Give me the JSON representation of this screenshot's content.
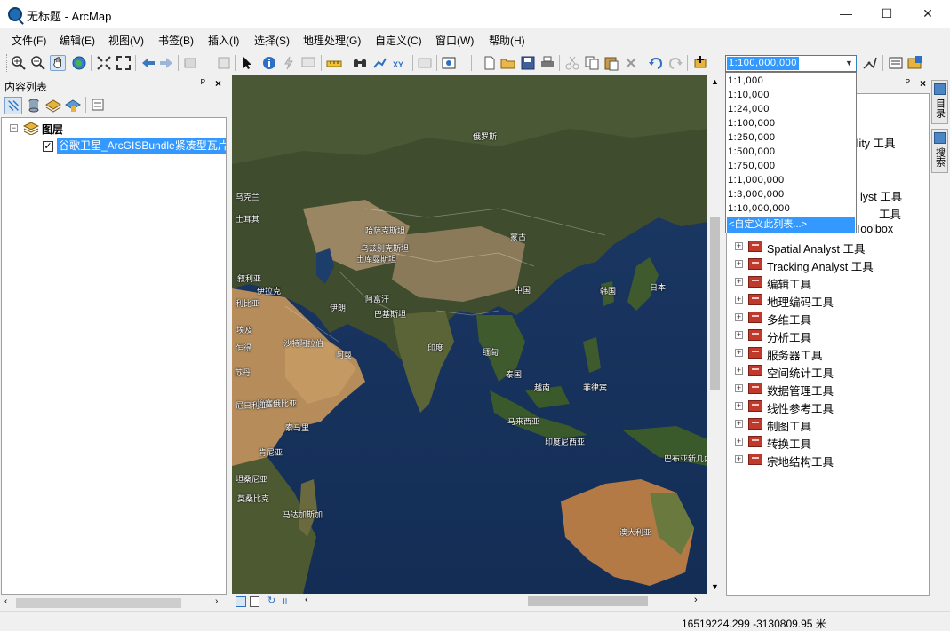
{
  "window": {
    "title": "无标题 - ArcMap",
    "minimize": "—",
    "maximize": "☐",
    "close": "✕"
  },
  "menu": [
    "文件(F)",
    "编辑(E)",
    "视图(V)",
    "书签(B)",
    "插入(I)",
    "选择(S)",
    "地理处理(G)",
    "自定义(C)",
    "窗口(W)",
    "帮助(H)"
  ],
  "toolbar": {
    "scale_value": "1:100,000,000",
    "scale_options": [
      "1:1,000",
      "1:10,000",
      "1:24,000",
      "1:100,000",
      "1:250,000",
      "1:500,000",
      "1:750,000",
      "1:1,000,000",
      "1:3,000,000",
      "1:10,000,000"
    ],
    "scale_customize": "<自定义此列表...>",
    "tool_icons": [
      "zoom-in-icon",
      "zoom-out-icon",
      "pan-icon",
      "full-extent-icon",
      "fixed-zoom-in-icon",
      "fixed-zoom-out-icon",
      "back-icon",
      "forward-icon",
      "select-elements-icon",
      "identify-icon",
      "find-icon",
      "measure-icon",
      "new-icon",
      "open-icon",
      "save-icon",
      "print-icon",
      "cut-icon",
      "copy-icon",
      "paste-icon",
      "delete-icon",
      "undo-icon",
      "redo-icon",
      "add-data-icon"
    ]
  },
  "toc": {
    "title": "内容列表",
    "pin": "ᴾ",
    "close": "×",
    "group_label": "图层",
    "layer_label": "谷歌卫星_ArcGISBundle紧凑型瓦片",
    "layer_checked": "✓"
  },
  "catalog": {
    "pin": "ᴾ",
    "close": "×",
    "partial_items": [
      "ility 工具",
      "lyst 工具",
      "工具",
      "Toolbox"
    ],
    "tools": [
      "Spatial Analyst 工具",
      "Tracking Analyst 工具",
      "编辑工具",
      "地理编码工具",
      "多维工具",
      "分析工具",
      "服务器工具",
      "空间统计工具",
      "数据管理工具",
      "线性参考工具",
      "制图工具",
      "转换工具",
      "宗地结构工具"
    ]
  },
  "side_tabs": [
    "目录",
    "搜索"
  ],
  "map_labels": [
    "俄罗斯",
    "哈萨克斯坦",
    "蒙古",
    "中国",
    "日本",
    "韩国",
    "印度",
    "伊朗",
    "沙特阿拉伯",
    "埃及",
    "阿曼",
    "巴基斯坦",
    "阿富汗",
    "土库曼斯坦",
    "乌兹别克斯坦",
    "缅甸",
    "泰国",
    "越南",
    "菲律宾",
    "马来西亚",
    "印度尼西亚",
    "苏丹",
    "埃塞俄比亚",
    "索马里",
    "肯尼亚",
    "坦桑尼亚",
    "马达加斯加",
    "莫桑比克",
    "澳大利亚",
    "巴布亚新几内亚",
    "伊拉克",
    "叙利亚",
    "土耳其",
    "乌克兰",
    "利比亚",
    "乍得",
    "尼日利亚"
  ],
  "status": {
    "coordinates": "16519224.299  -3130809.95 米"
  }
}
